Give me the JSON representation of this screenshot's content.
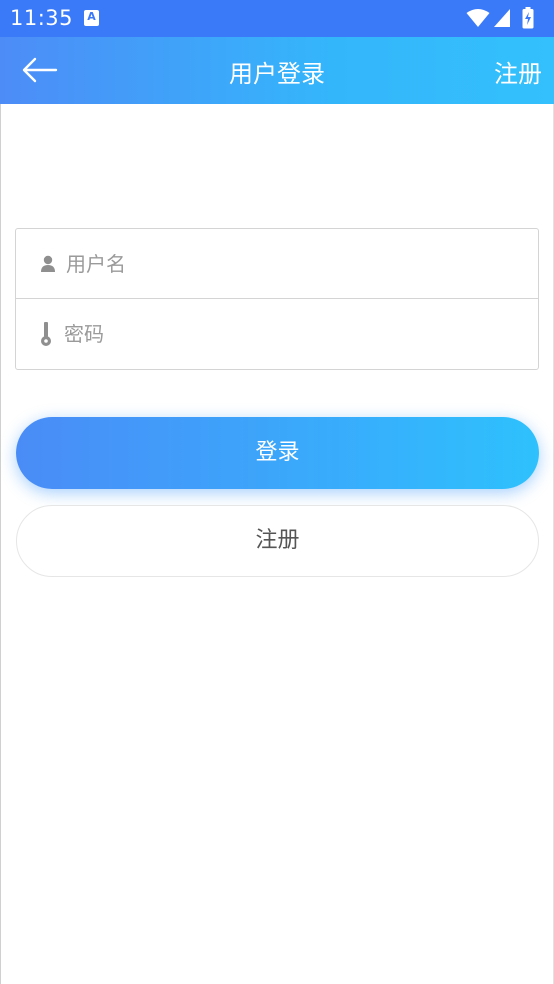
{
  "status_bar": {
    "time": "11:35",
    "app_icon_letter": "A",
    "icons": [
      "wifi-icon",
      "signal-icon",
      "battery-charging-icon"
    ]
  },
  "header": {
    "back_icon": "arrow-left-icon",
    "title": "用户登录",
    "register_label": "注册",
    "gradient_start": "#4d8cf7",
    "gradient_end": "#33c0fc"
  },
  "form": {
    "username": {
      "placeholder": "用户名",
      "value": "",
      "icon": "user-icon"
    },
    "password": {
      "placeholder": "密码",
      "value": "",
      "icon": "key-icon"
    }
  },
  "buttons": {
    "login_label": "登录",
    "register_label": "注册"
  },
  "colors": {
    "accent": "#3a7af9",
    "accent_light": "#2ec1fd",
    "placeholder": "#9a9a9a",
    "border": "#d4d4d4"
  }
}
